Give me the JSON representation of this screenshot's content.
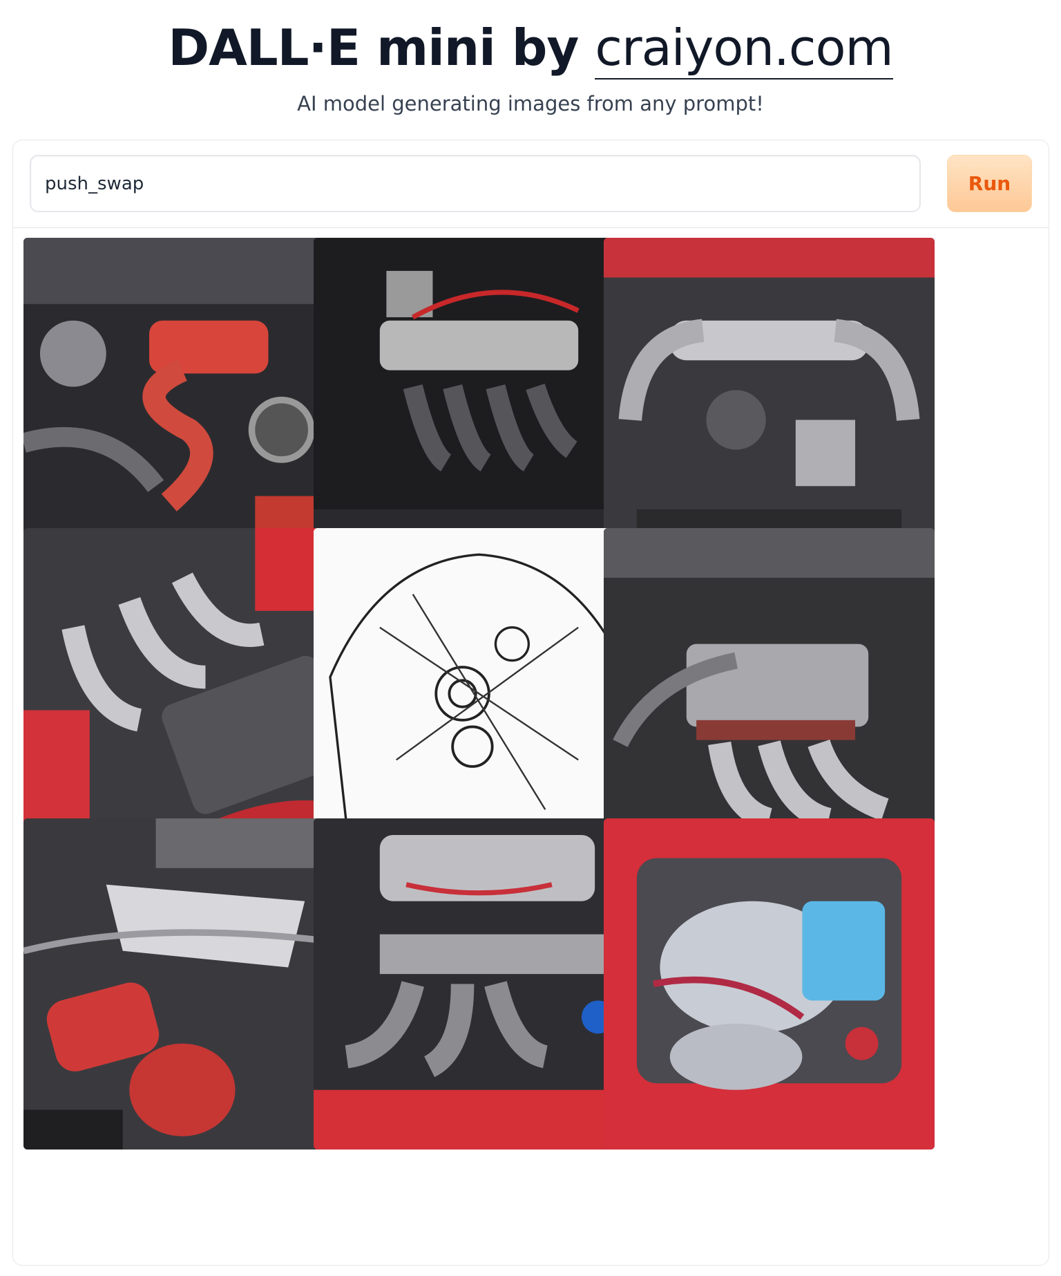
{
  "header": {
    "title_bold": "DALL·E mini by ",
    "title_link": "craiyon.com",
    "subtitle": "AI model generating images from any prompt!"
  },
  "prompt": {
    "value": "push_swap"
  },
  "run_button": {
    "label": "Run"
  },
  "results": [
    {
      "name": "engine-image-1",
      "palette": "dark-red"
    },
    {
      "name": "engine-image-2",
      "palette": "dark-silver-red"
    },
    {
      "name": "engine-image-3",
      "palette": "silver-red"
    },
    {
      "name": "engine-image-4",
      "palette": "silver-dark-red"
    },
    {
      "name": "engine-image-5",
      "palette": "line-sketch"
    },
    {
      "name": "engine-image-6",
      "palette": "silver-dark"
    },
    {
      "name": "engine-image-7",
      "palette": "silver-red"
    },
    {
      "name": "engine-image-8",
      "palette": "silver-red-floor"
    },
    {
      "name": "engine-image-9",
      "palette": "red-blue"
    }
  ]
}
